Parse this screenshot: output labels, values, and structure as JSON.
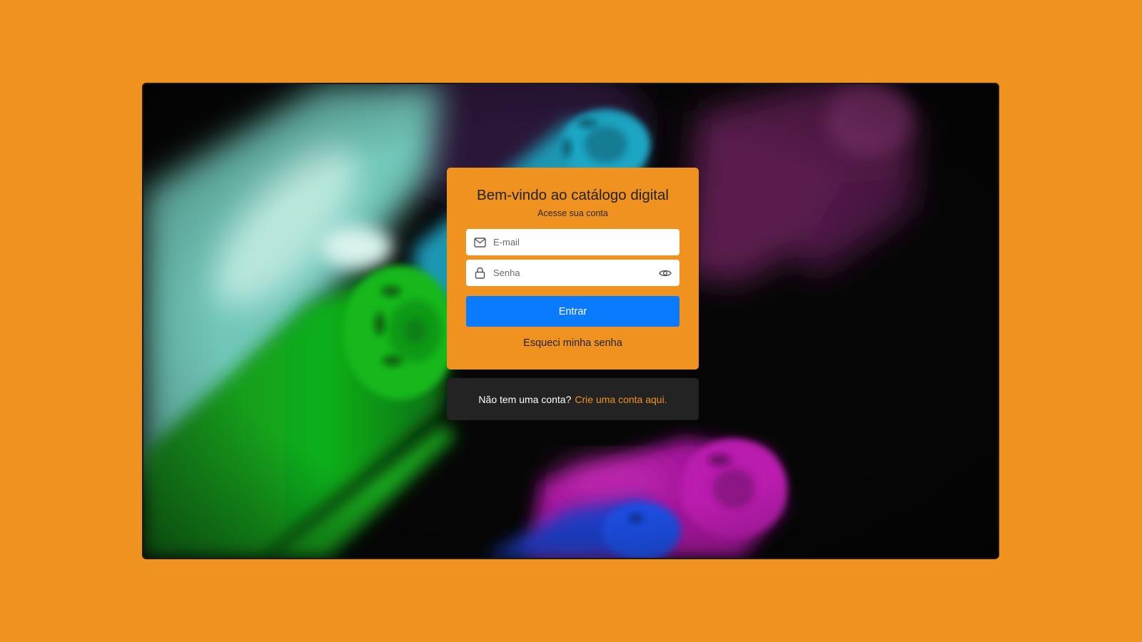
{
  "login": {
    "title": "Bem-vindo ao catálogo digital",
    "subtitle": "Acesse sua conta",
    "email_placeholder": "E-mail",
    "password_placeholder": "Senha",
    "submit_label": "Entrar",
    "forgot_label": "Esqueci minha senha"
  },
  "signup": {
    "prompt": "Não tem uma conta?",
    "link_label": "Crie uma conta aqui."
  },
  "icons": {
    "email": "mail-icon",
    "password": "lock-icon",
    "toggle_password": "eye-icon"
  },
  "colors": {
    "page_background": "#F0921F",
    "card_background": "#F0921F",
    "primary_button": "#0A7BFF",
    "signup_panel": "#232323",
    "link_accent": "#F0921F"
  }
}
